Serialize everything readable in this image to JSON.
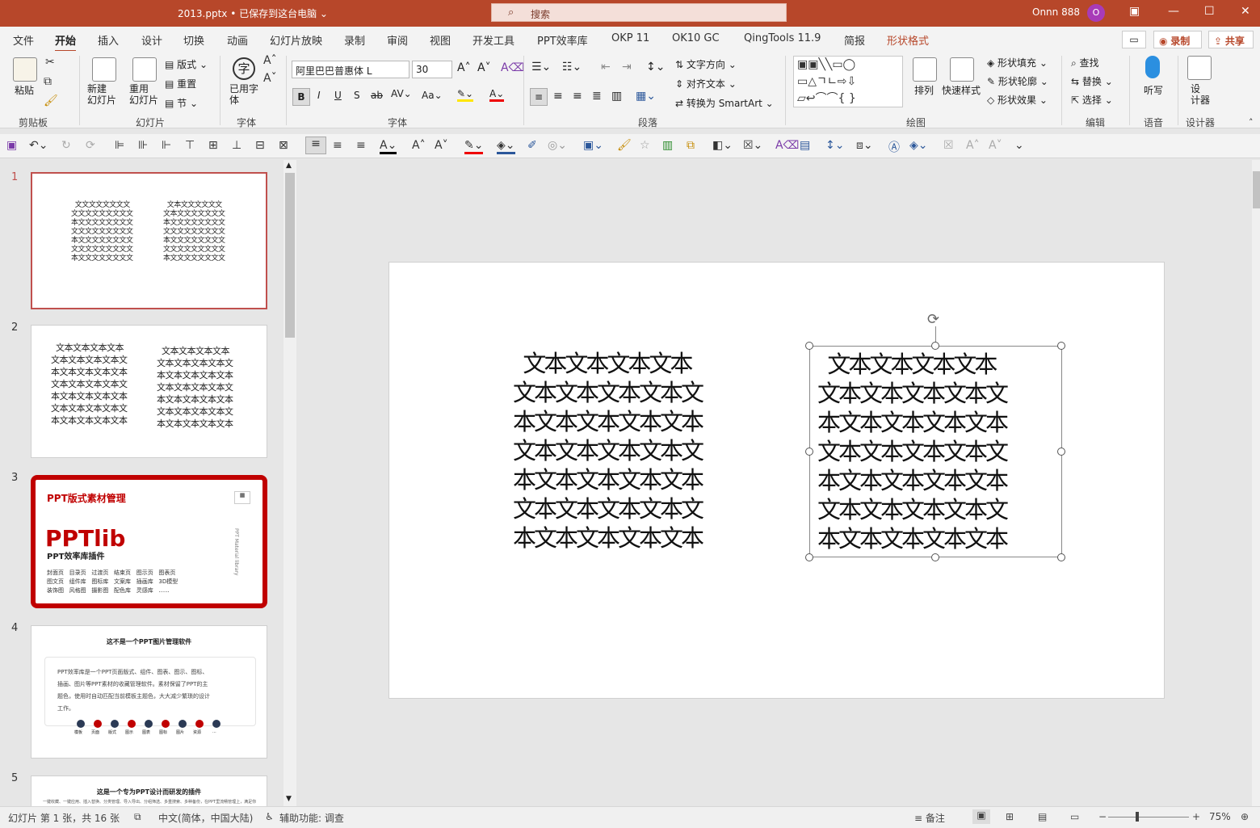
{
  "window": {
    "title": "2013.pptx • 已保存到这台电脑 ⌄",
    "search_placeholder": "搜索",
    "user": "Onnn 888",
    "avatar_initial": "O",
    "accent": "#b7472a"
  },
  "tabs": [
    "文件",
    "开始",
    "插入",
    "设计",
    "切换",
    "动画",
    "幻灯片放映",
    "录制",
    "审阅",
    "视图",
    "开发工具",
    "PPT效率库",
    "OKP 11",
    "OK10 GC",
    "QingTools 11.9",
    "简报",
    "形状格式"
  ],
  "tab_actions": {
    "record": "录制",
    "share": "共享"
  },
  "ribbon": {
    "clipboard": {
      "paste": "粘贴",
      "group": "剪贴板"
    },
    "slides": {
      "new_slide": "新建\n幻灯片",
      "reuse": "重用\n幻灯片",
      "layout": "版式",
      "reset": "重置",
      "section": "节",
      "group": "幻灯片"
    },
    "font_group_used": {
      "label": "已用字\n体",
      "group": "字体"
    },
    "font": {
      "name": "阿里巴巴普惠体 L",
      "size": "30",
      "group": "字体"
    },
    "paragraph": {
      "text_direction": "文字方向",
      "align_text": "对齐文本",
      "smartart": "转换为 SmartArt",
      "group": "段落"
    },
    "drawing": {
      "arrange": "排列",
      "quick_styles": "快速样式",
      "fill": "形状填充",
      "outline": "形状轮廓",
      "effects": "形状效果",
      "group": "绘图"
    },
    "editing": {
      "find": "查找",
      "replace": "替换",
      "select": "选择",
      "group": "编辑"
    },
    "voice": {
      "dictate": "听写",
      "group": "语音"
    },
    "designer": {
      "label": "设\n计器",
      "group": "设计器"
    }
  },
  "thumbs": [
    {
      "num": "1",
      "lines_left": "  文文文文文文文文\n文文文文文文文文文\n本文文文文文文文文\n文文文文文文文文文\n本文文文文文文文文\n文文文文文文文文文\n本文文文文文文文文",
      "lines_right": "  文本文文文文文文\n文本文文文文文文文\n本文文文文文文文文\n文文文文文文文文文\n本文文文文文文文文\n文文文文文文文文文\n本文文文文文文文文"
    },
    {
      "num": "2",
      "lines_left": "  文本文本文本文本\n文本文本文本文本文\n本文本文本文本文本\n文本文本文本文本文\n本文本文本文本文本\n文本文本文本文本文\n本文本文本文本文本",
      "lines_right": "  文本文本文本文本\n文本文本文本文本文\n本文本文本文本文本\n文本文本文本文本文\n本文本文本文本文本\n文本文本文本文本文\n本文本文本文本文本"
    },
    {
      "num": "3",
      "title": "PPT版式素材管理",
      "brand": "PPTlib",
      "subtitle": "PPT效率库插件",
      "side": "PPT Material library",
      "items": "封面页   目录页   过渡页   结束页   图示页   图表页\n图文页   组件库   图标库   文案库   插画库   3D模型\n装饰图   风格图   摄影图   配色库   灵感库   ......"
    },
    {
      "num": "4",
      "title": "这不是一个PPT图片管理软件",
      "body": "PPT效率库是一个PPT页面版式、组件、图表、图示、图标、\n插画、图片等PPT素材的收藏管理软件。素材保留了PPT的主\n题色，使用时自动匹配当前模板主题色，大大减少繁琐的设计\n工作。",
      "icons": [
        "模板",
        "页面",
        "版式",
        "图示",
        "图表",
        "图标",
        "图片",
        "资源",
        "..."
      ]
    },
    {
      "num": "5",
      "title": "这是一个专为PPT设计而研发的插件",
      "body": "一键收藏、一键应用、插入替换、分类管理、导入导出、分组筛选、多重搜索、多种备份，在PPT里流畅管理上，满足你"
    }
  ],
  "slide": {
    "left_text": "  文本文本文本文本\n文本文本文本文本文\n本文本文本文本文本\n文本文本文本文本文\n本文本文本文本文本\n文本文本文本文本文\n本文本文本文本文本",
    "right_text": "  文本文本文本文本\n文本文本文本文本文\n本文本文本文本文本\n文本文本文本文本文\n本文本文本文本文本\n文本文本文本文本文\n本文本文本文本文本"
  },
  "status": {
    "slide_info": "幻灯片 第 1 张，共 16 张",
    "language": "中文(简体，中国大陆)",
    "accessibility": "辅助功能: 调查",
    "notes": "备注",
    "zoom": "75%"
  }
}
